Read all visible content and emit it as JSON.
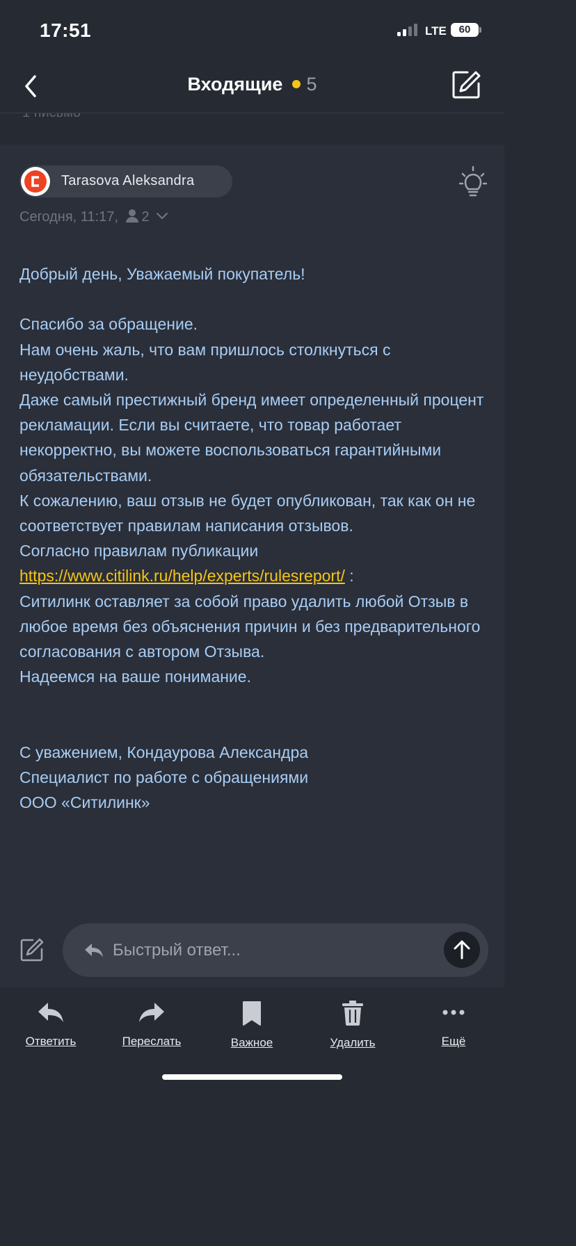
{
  "status_bar": {
    "time": "17:51",
    "network": "LTE",
    "battery": "60"
  },
  "header": {
    "title": "Входящие",
    "unread_count": "5",
    "unread_dot_color": "#f5c518"
  },
  "folder_strip": {
    "text": "1 письмо"
  },
  "message": {
    "sender": "Tarasova Aleksandra",
    "date": "Сегодня, 11:17,",
    "recipients_count": "2",
    "icons": [
      "citilink-logo-avatar",
      "bulb-icon",
      "person-icon",
      "chevron-down-icon"
    ],
    "body": {
      "greeting": "Добрый день, Уважаемый покупатель!",
      "p1": "Спасибо за обращение.",
      "p2": "Нам очень жаль, что вам пришлось столкнуться с неудобствами.",
      "p3": "Даже самый престижный бренд имеет определенный процент рекламации. Если вы считаете, что товар работает некорректно, вы можете воспользоваться гарантийными обязательствами.",
      "p4": "К сожалению, ваш отзыв не будет опубликован, так как он не соответствует правилам написания отзывов.",
      "p5": "Согласно правилам публикации",
      "link": "https://www.citilink.ru/help/experts/rulesreport/",
      "link_suffix": " :",
      "p6": "Ситилинк оставляет за собой право удалить любой Отзыв в любое время без объяснения причин и без предварительного согласования с автором Отзыва.",
      "p7": "Надеемся на ваше понимание.",
      "sign1": "С уважением, Кондаурова Александра",
      "sign2": "Специалист по работе с обращениями",
      "sign3": "ООО «Ситилинк»"
    }
  },
  "reply": {
    "placeholder": "Быстрый ответ..."
  },
  "toolbar": {
    "reply": "Ответить",
    "forward": "Переслать",
    "important": "Важное",
    "delete": "Удалить",
    "more": "Ещё"
  },
  "colors": {
    "background": "#262a33",
    "message_bg": "#2b2f39",
    "body_text": "#a7cdf5",
    "link": "#f5c518"
  }
}
